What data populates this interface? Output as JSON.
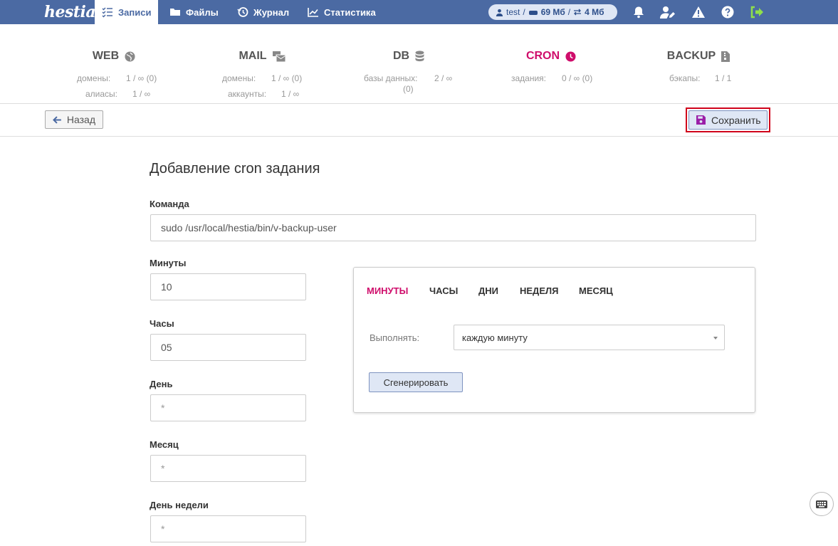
{
  "topbar": {
    "logo": "hestia",
    "nav": [
      {
        "label": "Записи",
        "icon": "list-check-icon",
        "active": true
      },
      {
        "label": "Файлы",
        "icon": "folder-icon",
        "active": false
      },
      {
        "label": "Журнал",
        "icon": "history-icon",
        "active": false
      },
      {
        "label": "Статистика",
        "icon": "chart-line-icon",
        "active": false
      }
    ],
    "user": {
      "name": "test",
      "sep1": "/",
      "disk": "69 Мб",
      "sep2": "/",
      "bandwidth": "4 Мб"
    },
    "icons": [
      "bell-icon",
      "user-edit-icon",
      "warning-icon",
      "help-icon",
      "logout-icon"
    ],
    "colors": {
      "bar": "#4b6aa3",
      "logout": "#8fe04a"
    }
  },
  "stats": [
    {
      "title": "WEB",
      "icon": "globe-icon",
      "lines": [
        {
          "label": "домены:",
          "value": "1 / ∞ (0)"
        },
        {
          "label": "алиасы:",
          "value": "1 / ∞"
        }
      ]
    },
    {
      "title": "MAIL",
      "icon": "mail-bulk-icon",
      "lines": [
        {
          "label": "домены:",
          "value": "1 / ∞ (0)"
        },
        {
          "label": "аккаунты:",
          "value": "1 / ∞"
        }
      ]
    },
    {
      "title": "DB",
      "icon": "database-icon",
      "lines": [
        {
          "label": "базы данных:",
          "value": "2 / ∞"
        },
        {
          "label": "",
          "value": "(0)"
        }
      ]
    },
    {
      "title": "CRON",
      "icon": "clock-icon",
      "active": true,
      "lines": [
        {
          "label": "задания:",
          "value": "0 / ∞ (0)"
        }
      ]
    },
    {
      "title": "BACKUP",
      "icon": "file-archive-icon",
      "lines": [
        {
          "label": "бэкапы:",
          "value": "1 / 1"
        }
      ]
    }
  ],
  "toolbar": {
    "back_label": "Назад",
    "save_label": "Сохранить"
  },
  "form": {
    "title": "Добавление cron задания",
    "command_label": "Команда",
    "command_value": "sudo /usr/local/hestia/bin/v-backup-user",
    "minutes_label": "Минуты",
    "minutes_value": "10",
    "hours_label": "Часы",
    "hours_value": "05",
    "day_label": "День",
    "day_value": "*",
    "month_label": "Месяц",
    "month_value": "*",
    "weekday_label": "День недели",
    "weekday_value": "*"
  },
  "generator": {
    "tabs": [
      "МИНУТЫ",
      "ЧАСЫ",
      "ДНИ",
      "НЕДЕЛЯ",
      "МЕСЯЦ"
    ],
    "active_tab": 0,
    "run_label": "Выполнять:",
    "run_value": "каждую минуту",
    "generate_label": "Сгенерировать"
  },
  "accent_color": "#cf0d6b"
}
